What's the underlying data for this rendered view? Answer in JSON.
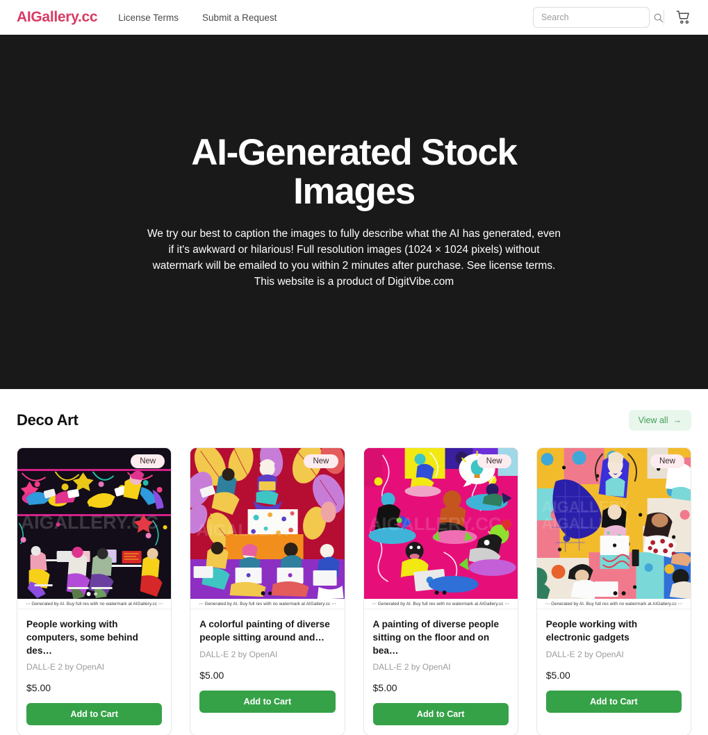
{
  "header": {
    "logo": "AIGallery.cc",
    "nav": [
      {
        "label": "License Terms",
        "name": "nav-license-terms"
      },
      {
        "label": "Submit a Request",
        "name": "nav-submit-request"
      }
    ],
    "search": {
      "placeholder": "Search",
      "value": ""
    },
    "search_icon": "search-icon",
    "cart_icon": "shopping-cart-icon"
  },
  "hero": {
    "title": "AI-Generated Stock Images",
    "subtitle": "We try our best to caption the images to fully describe what the AI has generated, even if it's awkward or hilarious! Full resolution images (1024 × 1024 pixels) without watermark will be emailed to you within 2 minutes after purchase. See license terms. This website is a product of DigitVibe.com",
    "background_color": "#191919"
  },
  "section": {
    "title": "Deco Art",
    "view_all_label": "View all",
    "view_all_arrow": "→",
    "view_all_bg": "#e9f6ec",
    "view_all_fg": "#3f9e56"
  },
  "watermark_text": "⋯ Generated by AI. Buy full res with no watermark at AIGallery.cc ⋯",
  "badge_label": "New",
  "add_to_cart_label": "Add to Cart",
  "accent_green": "#36a248",
  "brand_pink": "#d93a63",
  "products": [
    {
      "title": "People working with computers, some behind des…",
      "model": "DALL-E 2 by OpenAI",
      "price": "$5.00",
      "badge": "New",
      "button": "Add to Cart",
      "watermark": "⋯ Generated by AI. Buy full res with no watermark at AIGallery.cc ⋯",
      "art_name": "deco-art-people-computers-dark"
    },
    {
      "title": "A colorful painting of diverse people sitting around and…",
      "model": "DALL-E 2 by OpenAI",
      "price": "$5.00",
      "badge": "New",
      "button": "Add to Cart",
      "watermark": "⋯ Generated by AI. Buy full res with no watermark at AIGallery.cc ⋯",
      "art_name": "deco-art-colorful-leaves-laptops"
    },
    {
      "title": "A painting of diverse people sitting on the floor and on bea…",
      "model": "DALL-E 2 by OpenAI",
      "price": "$5.00",
      "badge": "New",
      "button": "Add to Cart",
      "watermark": "⋯ Generated by AI. Buy full res with no watermark at AIGallery.cc ⋯",
      "art_name": "deco-art-magenta-floor-beanbags"
    },
    {
      "title": "People working with electronic gadgets",
      "model": "DALL-E 2 by OpenAI",
      "price": "$5.00",
      "badge": "New",
      "button": "Add to Cart",
      "watermark": "⋯ Generated by AI. Buy full res with no watermark at AIGallery.cc ⋯",
      "art_name": "deco-art-yellow-grid-gadgets"
    }
  ]
}
